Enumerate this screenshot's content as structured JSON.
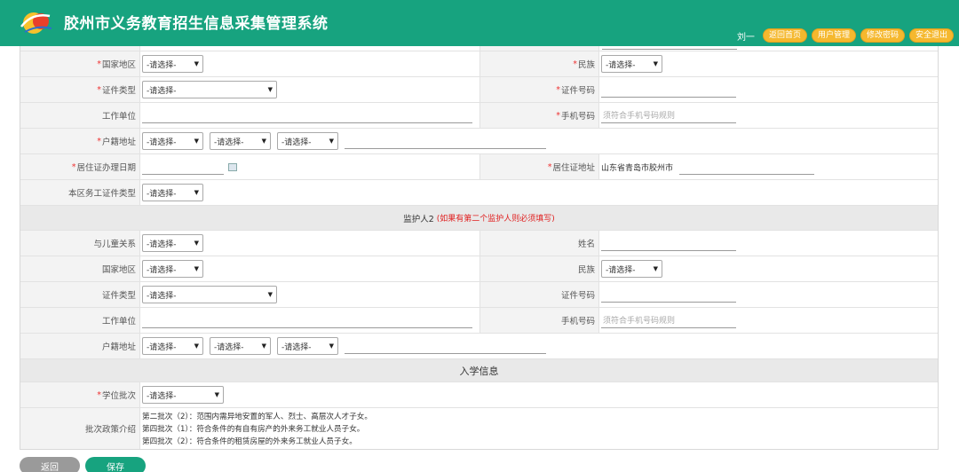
{
  "header": {
    "title": "胶州市义务教育招生信息采集管理系统",
    "user": "刘一",
    "nav": [
      "返回首页",
      "用户管理",
      "修改密码",
      "安全退出"
    ]
  },
  "placeholders": {
    "select": "-请选择-",
    "phone": "须符合手机号码规则"
  },
  "guardian1": {
    "country_label": "国家地区",
    "ethnicity_label": "民族",
    "id_type_label": "证件类型",
    "id_number_label": "证件号码",
    "work_label": "工作单位",
    "phone_label": "手机号码",
    "hukou_label": "户籍地址",
    "permit_date_label": "居住证办理日期",
    "permit_address_label": "居住证地址",
    "permit_address_value": "山东省青岛市胶州市",
    "worker_id_label": "本区务工证件类型"
  },
  "guardian2": {
    "section_title": "监护人2",
    "section_note": "(如果有第二个监护人则必须填写)",
    "relation_label": "与儿童关系",
    "name_label": "姓名",
    "country_label": "国家地区",
    "ethnicity_label": "民族",
    "id_type_label": "证件类型",
    "id_number_label": "证件号码",
    "work_label": "工作单位",
    "phone_label": "手机号码",
    "hukou_label": "户籍地址"
  },
  "enrollment": {
    "section_title": "入学信息",
    "batch_label": "学位批次",
    "policy_label": "批次政策介绍",
    "policy_lines": [
      "第二批次（2）：范围内需异地安置的军人、烈士、高层次人才子女。",
      "第四批次（1）：符合条件的有自有房产的外来务工就业人员子女。",
      "第四批次（2）：符合条件的租赁房屋的外来务工就业人员子女。"
    ]
  },
  "buttons": {
    "back": "返回",
    "save": "保存"
  },
  "colors": {
    "header_bg": "#17a37f",
    "pill_bg": "#f5b82e",
    "required": "#e33333",
    "note": "#e02020"
  }
}
